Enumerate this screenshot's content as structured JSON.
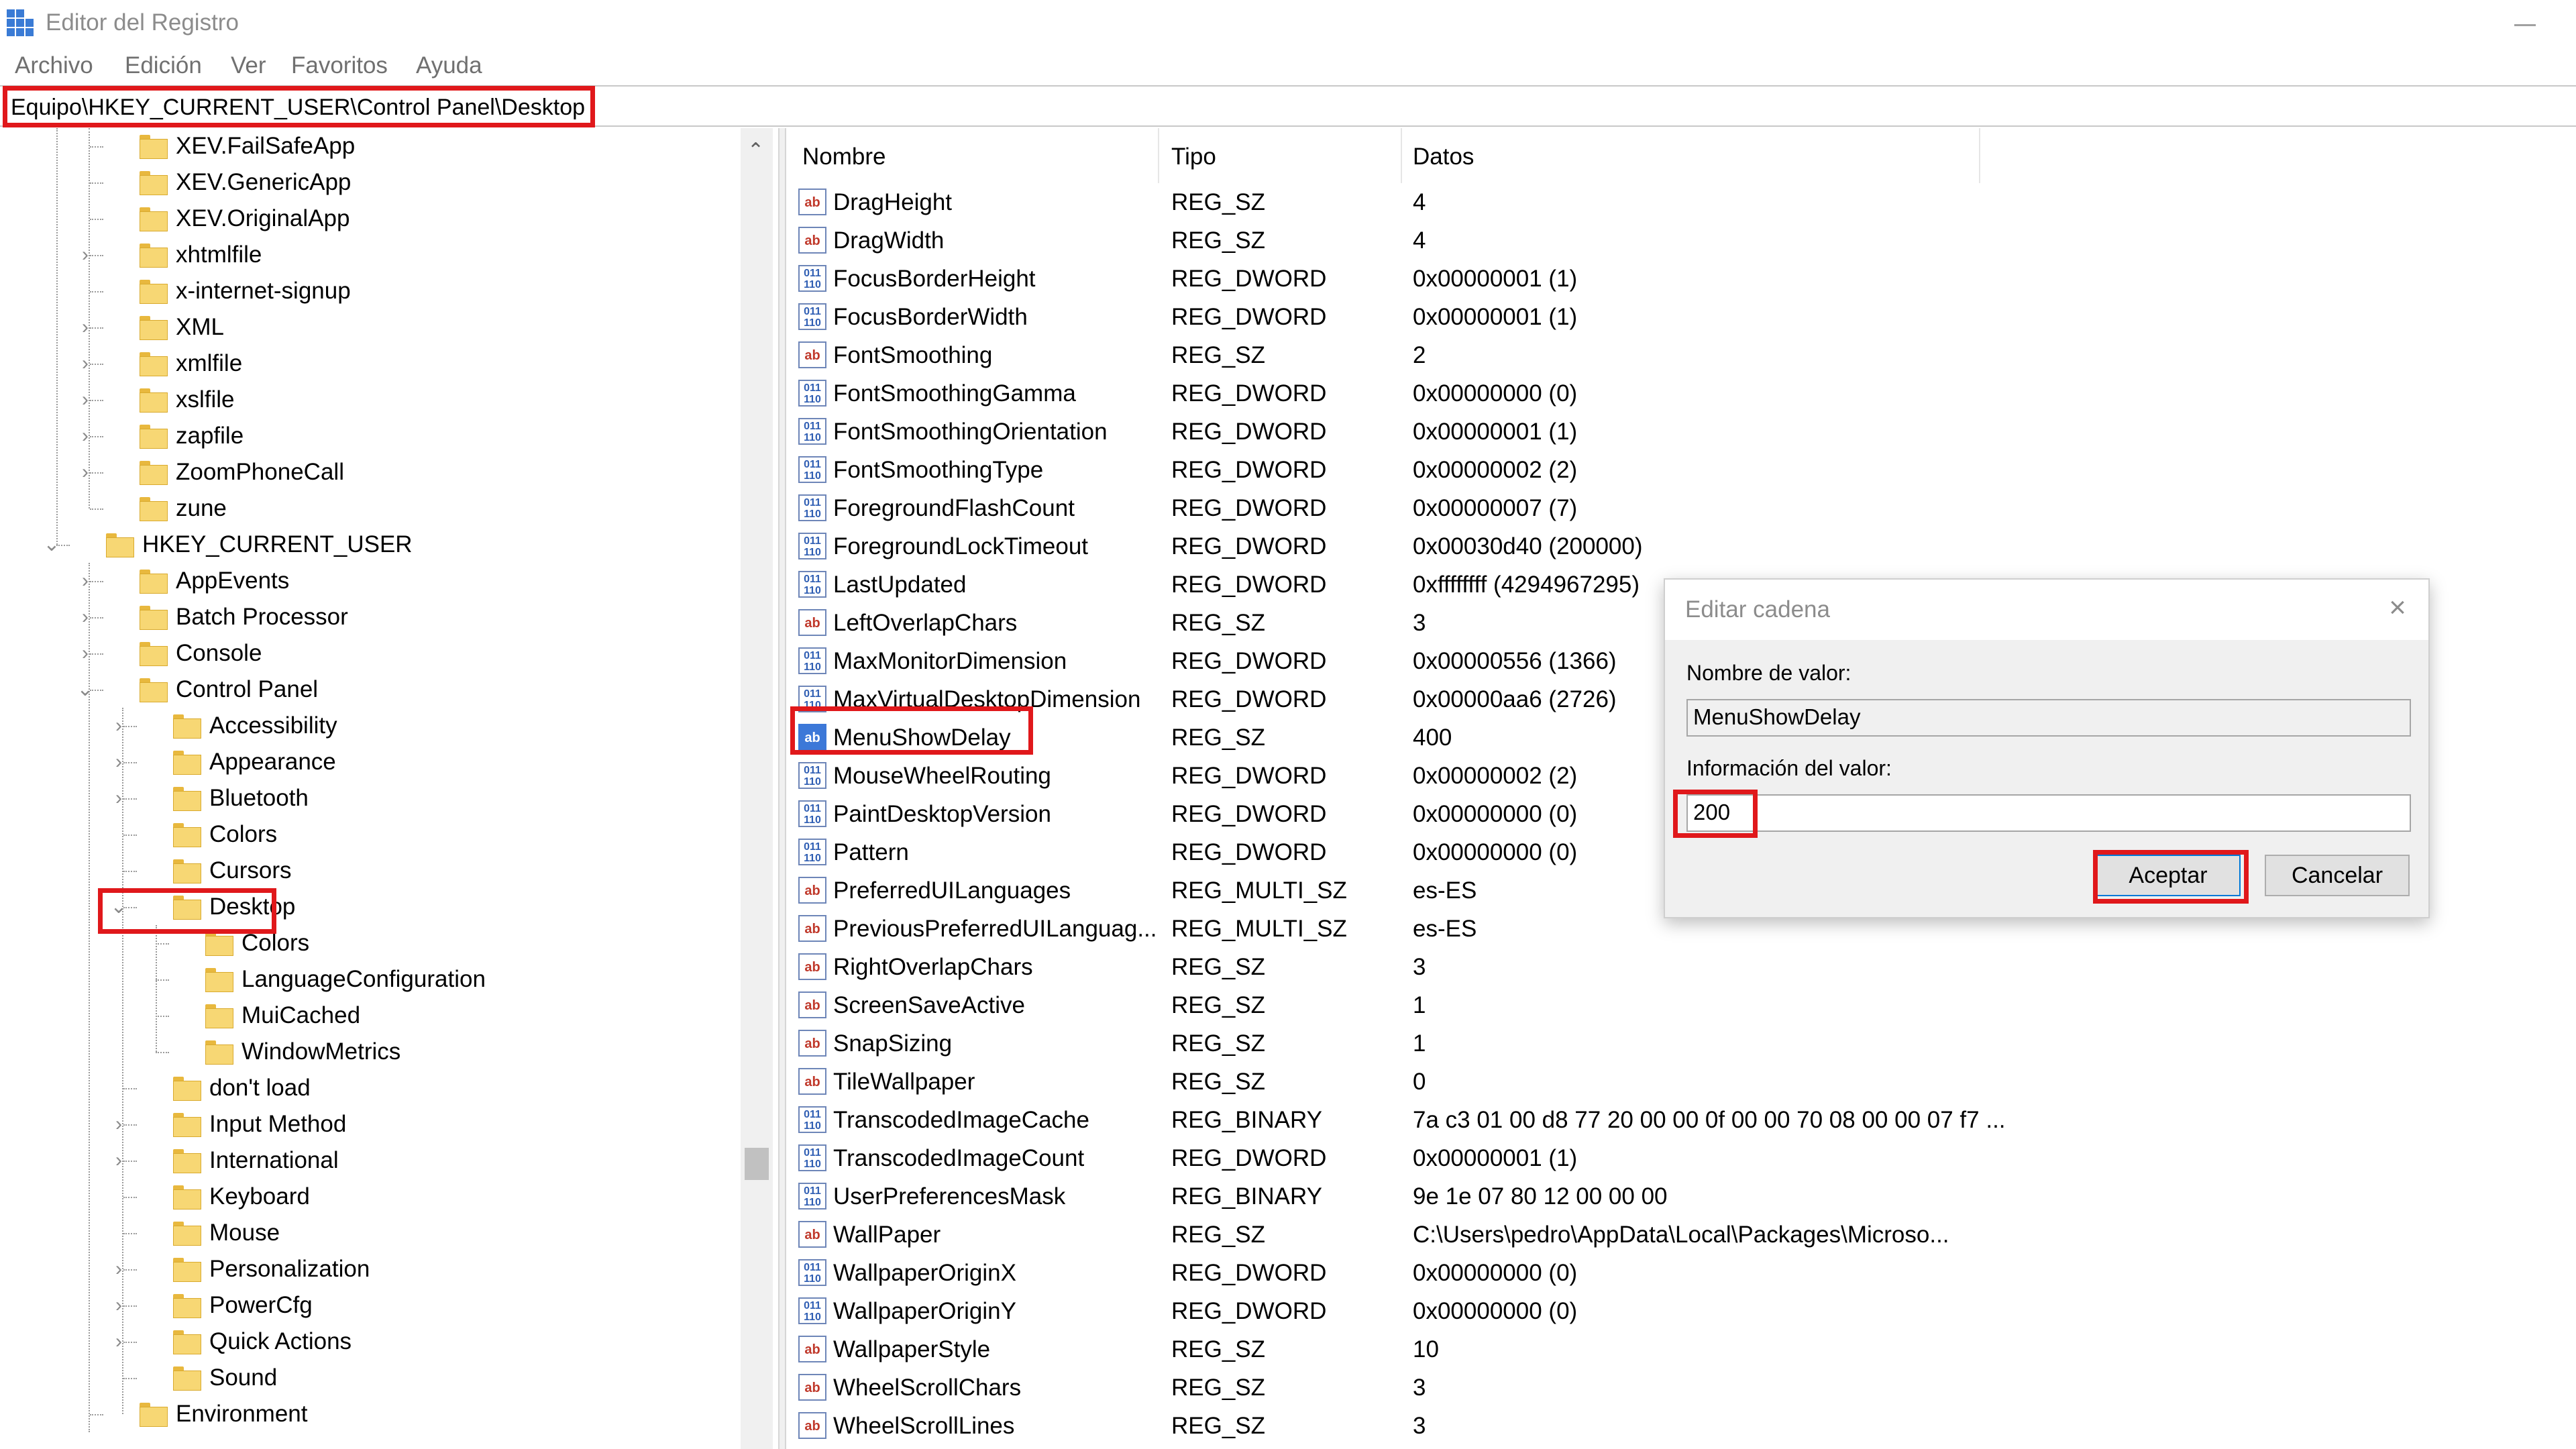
{
  "window": {
    "title": "Editor del Registro"
  },
  "menu": [
    "Archivo",
    "Edición",
    "Ver",
    "Favoritos",
    "Ayuda"
  ],
  "address": "Equipo\\HKEY_CURRENT_USER\\Control Panel\\Desktop",
  "tree": [
    {
      "label": "XEV.FailSafeApp",
      "level": 2,
      "expander": ""
    },
    {
      "label": "XEV.GenericApp",
      "level": 2,
      "expander": ""
    },
    {
      "label": "XEV.OriginalApp",
      "level": 2,
      "expander": ""
    },
    {
      "label": "xhtmlfile",
      "level": 2,
      "expander": "›"
    },
    {
      "label": "x-internet-signup",
      "level": 2,
      "expander": ""
    },
    {
      "label": "XML",
      "level": 2,
      "expander": "›"
    },
    {
      "label": "xmlfile",
      "level": 2,
      "expander": "›"
    },
    {
      "label": "xslfile",
      "level": 2,
      "expander": "›"
    },
    {
      "label": "zapfile",
      "level": 2,
      "expander": "›"
    },
    {
      "label": "ZoomPhoneCall",
      "level": 2,
      "expander": "›"
    },
    {
      "label": "zune",
      "level": 2,
      "expander": ""
    },
    {
      "label": "HKEY_CURRENT_USER",
      "level": 1,
      "expander": "⌄"
    },
    {
      "label": "AppEvents",
      "level": 2,
      "expander": "›"
    },
    {
      "label": "Batch Processor",
      "level": 2,
      "expander": "›"
    },
    {
      "label": "Console",
      "level": 2,
      "expander": "›"
    },
    {
      "label": "Control Panel",
      "level": 2,
      "expander": "⌄"
    },
    {
      "label": "Accessibility",
      "level": 3,
      "expander": "›"
    },
    {
      "label": "Appearance",
      "level": 3,
      "expander": "›"
    },
    {
      "label": "Bluetooth",
      "level": 3,
      "expander": "›"
    },
    {
      "label": "Colors",
      "level": 3,
      "expander": ""
    },
    {
      "label": "Cursors",
      "level": 3,
      "expander": ""
    },
    {
      "label": "Desktop",
      "level": 3,
      "expander": "⌄"
    },
    {
      "label": "Colors",
      "level": 4,
      "expander": ""
    },
    {
      "label": "LanguageConfiguration",
      "level": 4,
      "expander": ""
    },
    {
      "label": "MuiCached",
      "level": 4,
      "expander": ""
    },
    {
      "label": "WindowMetrics",
      "level": 4,
      "expander": ""
    },
    {
      "label": "don't load",
      "level": 3,
      "expander": ""
    },
    {
      "label": "Input Method",
      "level": 3,
      "expander": "›"
    },
    {
      "label": "International",
      "level": 3,
      "expander": "›"
    },
    {
      "label": "Keyboard",
      "level": 3,
      "expander": ""
    },
    {
      "label": "Mouse",
      "level": 3,
      "expander": ""
    },
    {
      "label": "Personalization",
      "level": 3,
      "expander": "›"
    },
    {
      "label": "PowerCfg",
      "level": 3,
      "expander": "›"
    },
    {
      "label": "Quick Actions",
      "level": 3,
      "expander": "›"
    },
    {
      "label": "Sound",
      "level": 3,
      "expander": ""
    },
    {
      "label": "Environment",
      "level": 2,
      "expander": ""
    }
  ],
  "list": {
    "headers": [
      "Nombre",
      "Tipo",
      "Datos"
    ],
    "rows": [
      {
        "name": "DragHeight",
        "type": "REG_SZ",
        "data": "4",
        "icon": "ab"
      },
      {
        "name": "DragWidth",
        "type": "REG_SZ",
        "data": "4",
        "icon": "ab"
      },
      {
        "name": "FocusBorderHeight",
        "type": "REG_DWORD",
        "data": "0x00000001 (1)",
        "icon": "bin"
      },
      {
        "name": "FocusBorderWidth",
        "type": "REG_DWORD",
        "data": "0x00000001 (1)",
        "icon": "bin"
      },
      {
        "name": "FontSmoothing",
        "type": "REG_SZ",
        "data": "2",
        "icon": "ab"
      },
      {
        "name": "FontSmoothingGamma",
        "type": "REG_DWORD",
        "data": "0x00000000 (0)",
        "icon": "bin"
      },
      {
        "name": "FontSmoothingOrientation",
        "type": "REG_DWORD",
        "data": "0x00000001 (1)",
        "icon": "bin"
      },
      {
        "name": "FontSmoothingType",
        "type": "REG_DWORD",
        "data": "0x00000002 (2)",
        "icon": "bin"
      },
      {
        "name": "ForegroundFlashCount",
        "type": "REG_DWORD",
        "data": "0x00000007 (7)",
        "icon": "bin"
      },
      {
        "name": "ForegroundLockTimeout",
        "type": "REG_DWORD",
        "data": "0x00030d40 (200000)",
        "icon": "bin"
      },
      {
        "name": "LastUpdated",
        "type": "REG_DWORD",
        "data": "0xffffffff (4294967295)",
        "icon": "bin"
      },
      {
        "name": "LeftOverlapChars",
        "type": "REG_SZ",
        "data": "3",
        "icon": "ab"
      },
      {
        "name": "MaxMonitorDimension",
        "type": "REG_DWORD",
        "data": "0x00000556 (1366)",
        "icon": "bin"
      },
      {
        "name": "MaxVirtualDesktopDimension",
        "type": "REG_DWORD",
        "data": "0x00000aa6 (2726)",
        "icon": "bin"
      },
      {
        "name": "MenuShowDelay",
        "type": "REG_SZ",
        "data": "400",
        "icon": "ab",
        "selected": true
      },
      {
        "name": "MouseWheelRouting",
        "type": "REG_DWORD",
        "data": "0x00000002 (2)",
        "icon": "bin"
      },
      {
        "name": "PaintDesktopVersion",
        "type": "REG_DWORD",
        "data": "0x00000000 (0)",
        "icon": "bin"
      },
      {
        "name": "Pattern",
        "type": "REG_DWORD",
        "data": "0x00000000 (0)",
        "icon": "bin"
      },
      {
        "name": "PreferredUILanguages",
        "type": "REG_MULTI_SZ",
        "data": "es-ES",
        "icon": "ab"
      },
      {
        "name": "PreviousPreferredUILanguag...",
        "type": "REG_MULTI_SZ",
        "data": "es-ES",
        "icon": "ab"
      },
      {
        "name": "RightOverlapChars",
        "type": "REG_SZ",
        "data": "3",
        "icon": "ab"
      },
      {
        "name": "ScreenSaveActive",
        "type": "REG_SZ",
        "data": "1",
        "icon": "ab"
      },
      {
        "name": "SnapSizing",
        "type": "REG_SZ",
        "data": "1",
        "icon": "ab"
      },
      {
        "name": "TileWallpaper",
        "type": "REG_SZ",
        "data": "0",
        "icon": "ab"
      },
      {
        "name": "TranscodedImageCache",
        "type": "REG_BINARY",
        "data": "7a c3 01 00 d8 77 20 00 00 0f 00 00 70 08 00 00 07 f7 ...",
        "icon": "bin"
      },
      {
        "name": "TranscodedImageCount",
        "type": "REG_DWORD",
        "data": "0x00000001 (1)",
        "icon": "bin"
      },
      {
        "name": "UserPreferencesMask",
        "type": "REG_BINARY",
        "data": "9e 1e 07 80 12 00 00 00",
        "icon": "bin"
      },
      {
        "name": "WallPaper",
        "type": "REG_SZ",
        "data": "C:\\Users\\pedro\\AppData\\Local\\Packages\\Microso...",
        "icon": "ab"
      },
      {
        "name": "WallpaperOriginX",
        "type": "REG_DWORD",
        "data": "0x00000000 (0)",
        "icon": "bin"
      },
      {
        "name": "WallpaperOriginY",
        "type": "REG_DWORD",
        "data": "0x00000000 (0)",
        "icon": "bin"
      },
      {
        "name": "WallpaperStyle",
        "type": "REG_SZ",
        "data": "10",
        "icon": "ab"
      },
      {
        "name": "WheelScrollChars",
        "type": "REG_SZ",
        "data": "3",
        "icon": "ab"
      },
      {
        "name": "WheelScrollLines",
        "type": "REG_SZ",
        "data": "3",
        "icon": "ab"
      }
    ]
  },
  "dialog": {
    "title": "Editar cadena",
    "value_name_label": "Nombre de valor:",
    "value_name": "MenuShowDelay",
    "value_data_label": "Información del valor:",
    "value_data": "200",
    "accept_label": "Aceptar",
    "cancel_label": "Cancelar"
  },
  "icons": {
    "string_value": "ab",
    "binary_value": "011\n110"
  },
  "colors": {
    "highlight": "#e0181b",
    "folder": "#f7d774",
    "selection": "#3c78d8"
  }
}
